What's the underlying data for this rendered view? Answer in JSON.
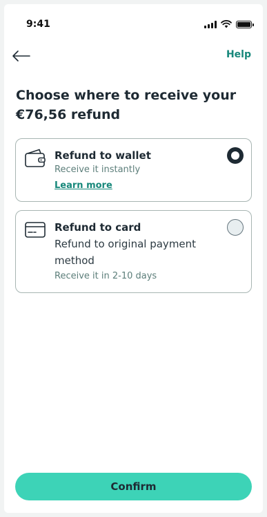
{
  "status_bar": {
    "time": "9:41"
  },
  "header": {
    "help_label": "Help"
  },
  "title": "Choose where to receive your €76,56 refund",
  "options": [
    {
      "title": "Refund to wallet",
      "subtitle": "Receive it instantly",
      "link": "Learn more",
      "selected": true,
      "icon": "wallet-icon"
    },
    {
      "title": "Refund to card",
      "description": "Refund to original payment method",
      "subtitle": "Receive it in 2-10 days",
      "selected": false,
      "icon": "credit-card-icon"
    }
  ],
  "confirm_label": "Confirm",
  "colors": {
    "accent": "#16877a",
    "button": "#3dd3b7",
    "text_dark": "#1e2a33",
    "text_muted": "#5c7e7a"
  }
}
